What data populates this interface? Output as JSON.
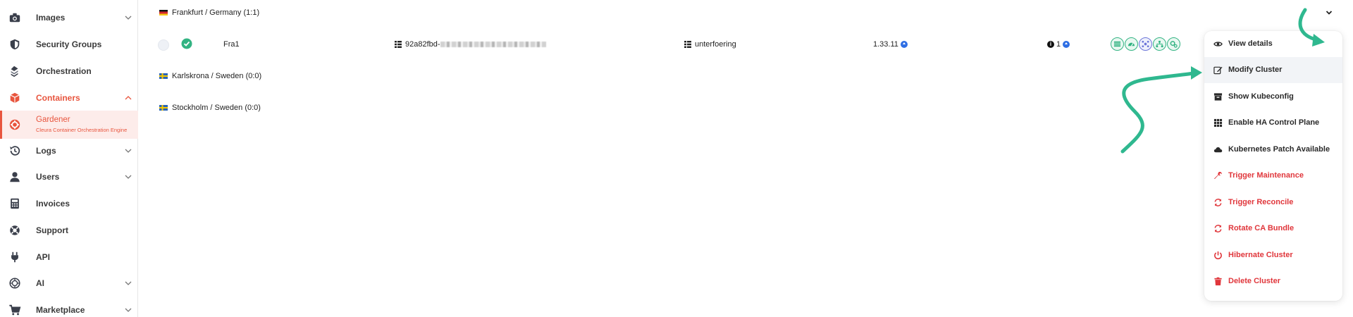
{
  "sidebar": {
    "items": [
      {
        "label": "Images",
        "icon": "camera-icon"
      },
      {
        "label": "Security Groups",
        "icon": "shield-icon"
      },
      {
        "label": "Orchestration",
        "icon": "layers-icon"
      },
      {
        "label": "Containers",
        "icon": "box-icon"
      },
      {
        "label": "Gardener",
        "sublabel": "Cleura Container Orchestration Engine",
        "icon": "gear-icon"
      },
      {
        "label": "Logs",
        "icon": "history-icon"
      },
      {
        "label": "Users",
        "icon": "user-icon"
      },
      {
        "label": "Invoices",
        "icon": "calculator-icon"
      },
      {
        "label": "Support",
        "icon": "lifebuoy-icon"
      },
      {
        "label": "API",
        "icon": "plug-icon"
      },
      {
        "label": "AI",
        "icon": "brain-icon"
      },
      {
        "label": "Marketplace",
        "icon": "cart-icon"
      }
    ]
  },
  "regions": [
    {
      "name": "Frankfurt / Germany",
      "count": "(1:1)"
    },
    {
      "name": "Karlskrona / Sweden",
      "count": "(0:0)"
    },
    {
      "name": "Stockholm / Sweden",
      "count": "(0:0)"
    }
  ],
  "cluster_row": {
    "name": "Fra1",
    "id_prefix": "92a82fbd-",
    "project": "unterfoering",
    "version": "1.33.11",
    "info_count": "1"
  },
  "menu": {
    "items": [
      {
        "label": "View details",
        "icon": "eye-icon"
      },
      {
        "label": "Modify Cluster",
        "icon": "edit-icon"
      },
      {
        "label": "Show Kubeconfig",
        "icon": "archive-icon"
      },
      {
        "label": "Enable HA Control Plane",
        "icon": "grid-icon"
      },
      {
        "label": "Kubernetes Patch Available",
        "icon": "cloud-icon"
      },
      {
        "label": "Trigger Maintenance",
        "icon": "wrench-icon"
      },
      {
        "label": "Trigger Reconcile",
        "icon": "sync-icon"
      },
      {
        "label": "Rotate CA Bundle",
        "icon": "sync-icon"
      },
      {
        "label": "Hibernate Cluster",
        "icon": "power-icon"
      },
      {
        "label": "Delete Cluster",
        "icon": "trash-icon"
      }
    ],
    "more_label": "•••"
  },
  "colors": {
    "accent": "#e8553e",
    "danger": "#e0363b",
    "success": "#32b382",
    "arrow": "#2fb88f",
    "info_blue": "#2f6fe4"
  }
}
